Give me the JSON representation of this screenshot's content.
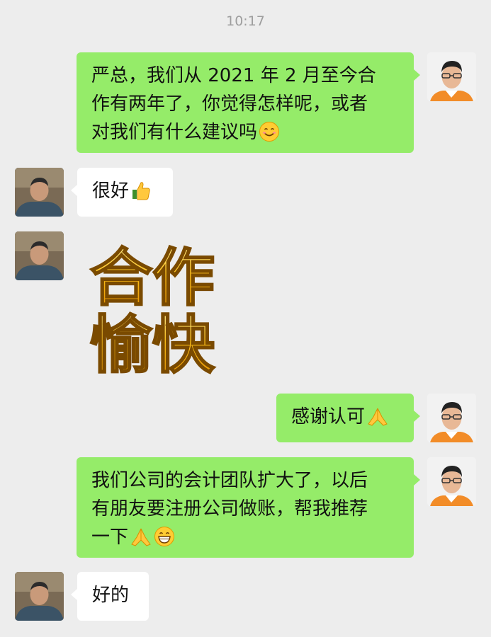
{
  "timestamp": "10:17",
  "messages": [
    {
      "sender": "me",
      "lines": [
        "严总，我们从 2021 年 2 月至今合",
        "作有两年了，你觉得怎样呢，或者",
        "对我们有什么建议吗"
      ],
      "emoji": "smiling-face"
    },
    {
      "sender": "other",
      "lines": [
        "很好"
      ],
      "emoji": "thumbs-up"
    },
    {
      "sender": "other",
      "sticker_lines": [
        "合作",
        "愉快"
      ]
    },
    {
      "sender": "me",
      "lines": [
        "感谢认可"
      ],
      "emoji": "folded-hands"
    },
    {
      "sender": "me",
      "lines": [
        "我们公司的会计团队扩大了，以后",
        "有朋友要注册公司做账，帮我推荐",
        "一下"
      ],
      "emoji": "folded-hands-grinning-face"
    },
    {
      "sender": "other",
      "lines": [
        "好的"
      ]
    }
  ],
  "colors": {
    "background": "#ededed",
    "my_bubble": "#95ec69",
    "other_bubble": "#ffffff",
    "sticker_gold": "#f5b800"
  }
}
